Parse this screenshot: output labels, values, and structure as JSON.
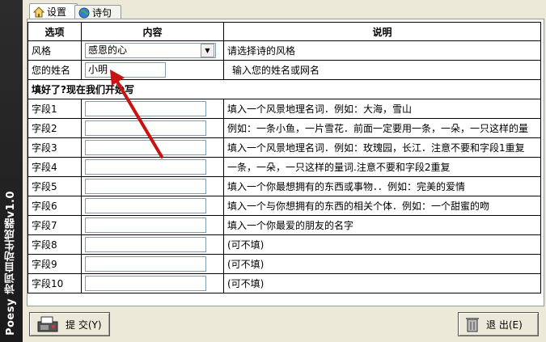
{
  "app": {
    "side_title": "Poesy 诗词自动生成器v1.0"
  },
  "tabs": [
    {
      "label": "设置",
      "icon": "home-icon",
      "active": true
    },
    {
      "label": "诗句",
      "icon": "globe-icon",
      "active": false
    }
  ],
  "table": {
    "headers": [
      "选项",
      "内容",
      "说明"
    ],
    "style_row": {
      "label": "风格",
      "value": "感恩的心",
      "desc": "请选择诗的风格"
    },
    "name_row": {
      "label": "您的姓名",
      "value": "小明",
      "desc": "输入您的姓名或网名"
    },
    "section_label": "填好了?现在我们开始写",
    "fields": [
      {
        "label": "字段1",
        "value": "",
        "desc": "填入一个风景地理名词．例如：大海，雪山"
      },
      {
        "label": "字段2",
        "value": "",
        "desc": "例如：一条小鱼，一片雪花．前面一定要用一条，一朵，一只这样的量"
      },
      {
        "label": "字段3",
        "value": "",
        "desc": "填入一个风景地理名词．例如：玫瑰园，长江．注意不要和字段1重复"
      },
      {
        "label": "字段4",
        "value": "",
        "desc": "一条，一朵，一只这样的量词.注意不要和字段2重复"
      },
      {
        "label": "字段5",
        "value": "",
        "desc": "填入一个你最想拥有的东西或事物．．例如：完美的爱情"
      },
      {
        "label": "字段6",
        "value": "",
        "desc": "填入一个与你想拥有的东西的相关个体．例如：一个甜蜜的吻"
      },
      {
        "label": "字段7",
        "value": "",
        "desc": "填入一个你最爱的朋友的名字"
      },
      {
        "label": "字段8",
        "value": "",
        "desc": "(可不填)"
      },
      {
        "label": "字段9",
        "value": "",
        "desc": "(可不填)"
      },
      {
        "label": "字段10",
        "value": "",
        "desc": "(可不填)"
      }
    ]
  },
  "buttons": {
    "submit": {
      "label": "提 交(Y)",
      "icon": "submit-fax-icon"
    },
    "exit": {
      "label": "退 出(E)",
      "icon": "trash-icon"
    }
  },
  "annotation": {
    "color": "#cc1111"
  }
}
